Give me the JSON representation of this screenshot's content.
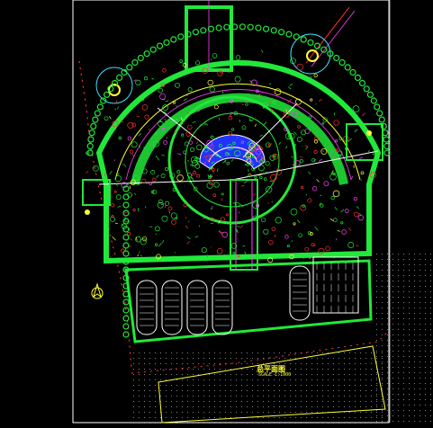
{
  "plan": {
    "title": "总平面图",
    "scale": "SCALE 1:1000"
  },
  "colors": {
    "background": "#000000",
    "frame": "#ffffff",
    "landscape": "#22e83a",
    "accent_red": "#ff3030",
    "water": "#2233ff",
    "title": "#ffff3a",
    "path_magenta": "#ff40ff",
    "road_cyan": "#40e0ff",
    "grid": "#d0d0d0"
  },
  "icons": {
    "north_arrow": "north-arrow-icon",
    "fountain": "fountain-icon"
  }
}
